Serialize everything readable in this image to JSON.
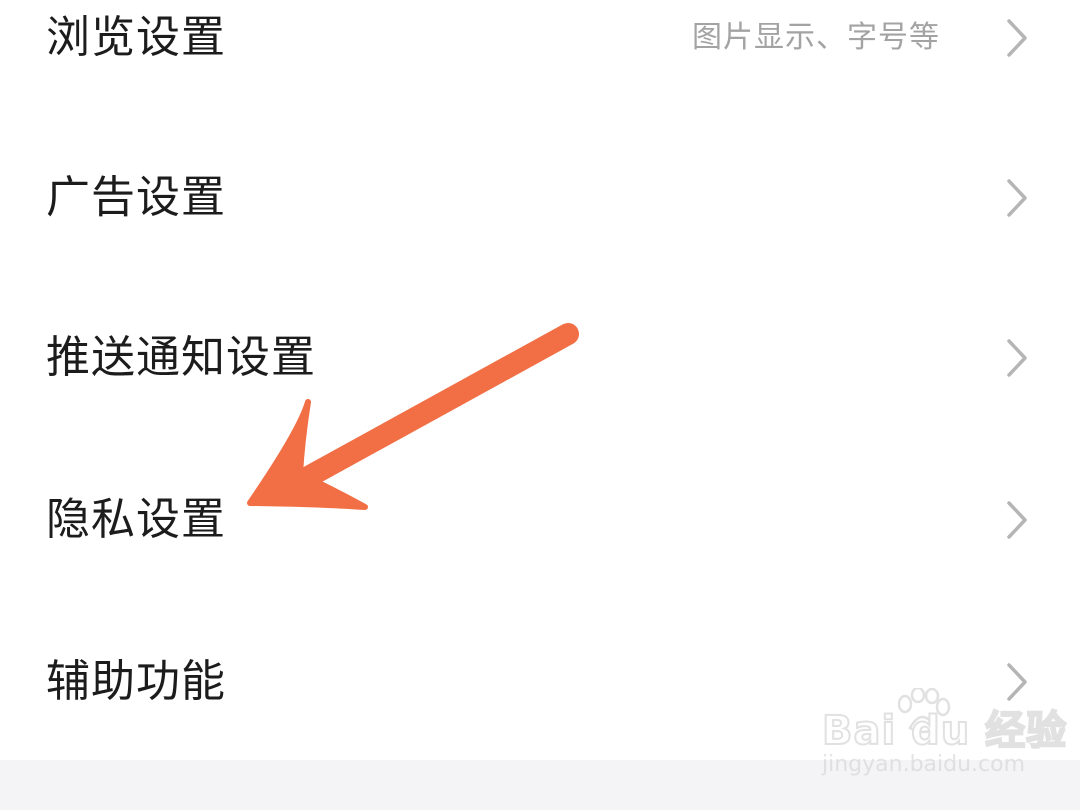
{
  "settings": {
    "items": [
      {
        "label": "浏览设置",
        "hint": "图片显示、字号等"
      },
      {
        "label": "广告设置",
        "hint": ""
      },
      {
        "label": "推送通知设置",
        "hint": ""
      },
      {
        "label": "隐私设置",
        "hint": ""
      },
      {
        "label": "辅助功能",
        "hint": ""
      }
    ],
    "chevron_icon": "chevron-right-icon"
  },
  "annotation": {
    "arrow_color": "#F26F45",
    "points_to": "隐私设置"
  },
  "watermark": {
    "brand": "Bai du 经验",
    "site": "jingyan.baidu.com"
  },
  "colors": {
    "background": "#FFFFFF",
    "label": "#1C1C1C",
    "hint": "#A3A3A3",
    "chevron": "#B5B5B5",
    "bottom_band": "#F4F4F6"
  }
}
